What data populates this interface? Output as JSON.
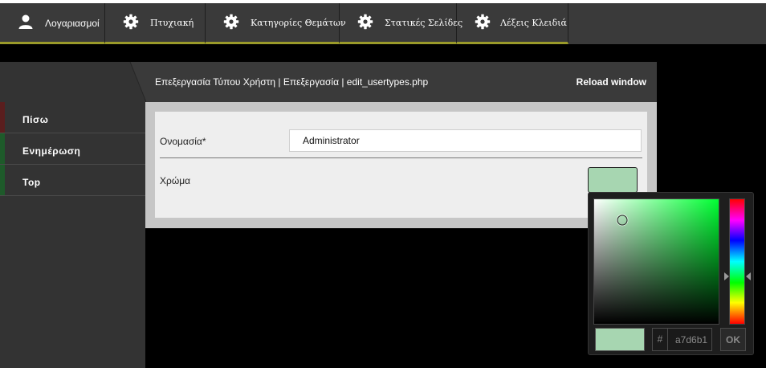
{
  "topnav": {
    "items": [
      {
        "label": "Λογαριασμοί",
        "icon": "user-icon"
      },
      {
        "label": "Πτυχιακή",
        "icon": "gear-icon"
      },
      {
        "label": "Κατηγορίες Θεμάτων",
        "icon": "gear-icon"
      },
      {
        "label": "Στατικές Σελίδες",
        "icon": "gear-icon"
      },
      {
        "label": "Λέξεις Κλειδιά",
        "icon": "gear-icon"
      }
    ]
  },
  "window": {
    "title": "Επεξεργασία Τύπου Χρήστη | Επεξεργασία | edit_usertypes.php",
    "reload_label": "Reload window"
  },
  "sidebar": {
    "items": [
      {
        "label": "Πίσω",
        "accent": "#5a1e1e"
      },
      {
        "label": "Ενημέρωση",
        "accent": "#1e5a2a"
      },
      {
        "label": "Top",
        "accent": "#1e5a2a"
      }
    ]
  },
  "form": {
    "name_label": "Ονομασία*",
    "name_value": "Administrator",
    "color_label": "Χρώμα",
    "color_value": "#a7d6b1"
  },
  "picker": {
    "hue_color": "#00ff33",
    "hash_symbol": "#",
    "hex_value": "a7d6b1",
    "ok_label": "OK"
  }
}
